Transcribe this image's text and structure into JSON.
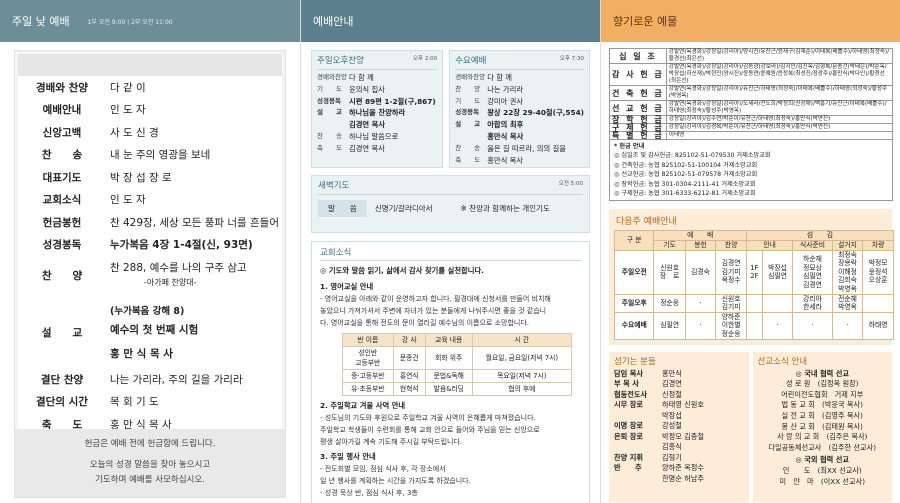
{
  "col1": {
    "header": "주일 낮 예배",
    "subtitle": "1부 오전 9:00 | 2부 오전 11:00",
    "order": [
      {
        "label": "경배와 찬양",
        "value": "다 같 이",
        "bold": false
      },
      {
        "label": "예배안내",
        "value": "인 도 자",
        "bold": false
      },
      {
        "label": "신앙고백",
        "value": "사 도 신 경",
        "bold": false
      },
      {
        "label": "찬　　송",
        "value": "내 눈 주의 영광을 보네",
        "bold": false
      },
      {
        "label": "대표기도",
        "value": "박 장 섭 장 로",
        "bold": false
      },
      {
        "label": "교회소식",
        "value": "인 도 자",
        "bold": false
      },
      {
        "label": "헌금봉헌",
        "value": "찬 429장, 세상 모든 풍파 너를 흔들어",
        "bold": false
      },
      {
        "label": "성경봉독",
        "value": "누가복음 4장 1-4절(신, 93면)",
        "bold": true
      }
    ],
    "praise": {
      "label": "찬　　양",
      "line1": "찬 288, 예수를 나의 구주 삼고",
      "line2": "-아가페 찬양대-"
    },
    "sermon": {
      "label": "설　　교",
      "line1": "(누가복음 강해 8)",
      "line2": "예수의 첫 번째 시험",
      "line3": "홍 만 식 목 사"
    },
    "closing": [
      {
        "label": "결단 찬양",
        "value": "나는 가리라, 주의 길을 가리라"
      },
      {
        "label": "결단의 시간",
        "value": "목 회 기 도"
      },
      {
        "label": "축　　도",
        "value": "홍 만 식 목 사"
      }
    ],
    "footer": [
      "헌금은 예배 전에 헌금함에 드립니다.",
      "오늘의 성경 말씀을 찾아 놓으시고",
      "기도하며 예배를 사모하십시오."
    ]
  },
  "col2": {
    "header": "예배안내",
    "sun_pm": {
      "title": "주일오후찬양",
      "time": "오후 2:00",
      "rows": [
        {
          "l": "경배와찬양",
          "v": "다 함 께",
          "b": false
        },
        {
          "l": "기　　도",
          "v": "윤의식 집사",
          "b": false
        },
        {
          "l": "성경봉독",
          "v": "시편 89편 1-2절(구,867)",
          "b": true
        },
        {
          "l": "설　　교",
          "v": "하나님을 찬양하라",
          "b": true
        },
        {
          "l": "",
          "v": "김경연 목사",
          "b": true
        },
        {
          "l": "찬　　송",
          "v": "하나님 말씀으로",
          "b": false
        },
        {
          "l": "축　　도",
          "v": "김경연 목사",
          "b": false
        }
      ]
    },
    "wed": {
      "title": "수요예배",
      "time": "오후 7:30",
      "rows": [
        {
          "l": "경배와찬양",
          "v": "다 함 께",
          "b": false
        },
        {
          "l": "찬　　양",
          "v": "나는 가리라",
          "b": false
        },
        {
          "l": "기　　도",
          "v": "강미아 권사",
          "b": false
        },
        {
          "l": "성경봉독",
          "v": "왕상 22장 29-40절(구,554)",
          "b": true
        },
        {
          "l": "설　　교",
          "v": "아합의 최후",
          "b": true
        },
        {
          "l": "",
          "v": "홍만식 목사",
          "b": true
        },
        {
          "l": "찬　　송",
          "v": "옳은 길 따르라, 의의 길을",
          "b": false
        },
        {
          "l": "축　　도",
          "v": "홍만식 목사",
          "b": false
        }
      ]
    },
    "dawn": {
      "title": "새벽기도",
      "time": "오전 5:00",
      "key": "말　　씀",
      "value": "신명기/갈라디아서",
      "note": "※ 찬양과 함께하는 개인기도"
    },
    "news": {
      "title": "교회소식",
      "lead": "◎ 기도와 말씀 읽기, 삶에서 감사 찾기를 실천합니다.",
      "s1_title": "1. 영어교실 안내",
      "s1_lines": [
        "- 영어교실을 아래와 같이 운영하고자 합니다. 필경대에 신청서를 만들어 비치해",
        "  놓았으니 가져가셔서 주변에 자녀가 있는 분들에게 나눠주시면 좋을 것 같습니",
        "  다. 영어교실을 통해 전도의 문이 열리길 예수님의 이름으로 소망합니다."
      ],
      "table_head": [
        "반 이름",
        "강 사",
        "교육 내용",
        "시 간"
      ],
      "table_rows": [
        [
          "성인반\n고등부반",
          "문종건",
          "회화 위주",
          "월요일, 금요일(저녁 7시)"
        ],
        [
          "중·고등부반",
          "홍연식",
          "문법&독해",
          "목요일(저녁 7시)"
        ],
        [
          "유·초등부반",
          "현혁석",
          "발음&리딩",
          "협의 후에"
        ]
      ],
      "s2_title": "2. 주일학교 겨울 사역 안내",
      "s2_lines": [
        "- 성도님의 기도와 후원으로 주일학교 겨울 사역이 은혜롭게 마쳐졌습니다.",
        "  주일학교 학생들이 수련회를 통해 교회 안으로 들어와 주님을 믿는 신앙으로",
        "  평생 살아가길 계속 기도해 주시길 부탁드립니다."
      ],
      "s3_title": "3. 주일 행사 안내",
      "s3_lines": [
        "- 전도회별 모임, 점심 식사 후, 각 장소에서",
        "  일 년 행사를 계획하는 시간을 가지도록 하겠습니다.",
        "- 성경 묵상 반, 점심 식사 후, 3층"
      ]
    }
  },
  "col3": {
    "header": "향기로운 예물",
    "giving": [
      {
        "k": "십 일 조",
        "v": "강발연(옥경화)/강창일(강리아)/양시진/유찬근/윤재구(김재순)/이태복(배틀수)/하태영(최정숙)/황경선(최은선)"
      },
      {
        "k": "감 사 헌 금",
        "v": "강발연(옥경화)/강창일(강리아)/김동광(강보라)/김지인/김진옥/김형복/문종건(박태은)/박순옥/박장섭(하신재)/박현진(양시진)/윤동연/윤예원/윤정복(최성진/정광주)/홍만식(박다인)/황경선(최은선)"
      },
      {
        "k": "건 축 헌 금",
        "v": "강발연(옥경화)/강창일(강리아)/유찬근/하태영(최정숙)/이태복(배틀수)/하태영(최정숙)/황성주(박영옥)"
      },
      {
        "k": "선 교 헌 금",
        "v": "강발연(옥경화)/강창일(강리아)/도세라/전도희/박정희(신상애)/백흥기/유찬근/이태복(배틀수)/하태영(최정숙)/황성주(박영옥)"
      },
      {
        "k": "장 학 헌 금",
        "v": "강창일(강리아)/김수연/박순이/유찬근/하태영(최정숙)/홍만식(박연진)"
      },
      {
        "k": "구 제 헌 금",
        "v": "강창일(강리아)/김경복/박순이/유찬근/하태영(최정숙)/홍만식(박연진)"
      },
      {
        "k": "특 별 헌 금",
        "v": "이태영"
      }
    ],
    "accounts_title": "* 헌금 안내",
    "accounts": [
      "◎ 십일조 및 감사헌금: 825102-51-079530 거제소망교회",
      "◎ 건축헌금: 농협 825102-51-100104 거제소망교회",
      "◎ 선교헌금: 농협 825102-51-079578 거제소망교회",
      "◎ 장학헌금: 농협 301-0304-2111-41 거제소망교회",
      "◎ 구제헌금: 농협 301-6333-6212-81 거제소망교회"
    ],
    "usher": {
      "title": "다음주 예배안내",
      "head1": [
        "구 분",
        "예　　배",
        "섬　　김"
      ],
      "head2": [
        "기도",
        "봉헌",
        "찬양",
        "안내",
        "식사준비",
        "설거지",
        "차량"
      ],
      "rows": [
        [
          "주일오전",
          "신원호\n장　로",
          "김경숙",
          "김경연\n김기미\n옥정수",
          "1F\n2F",
          "박장섭\n심필연",
          "하순재\n정묘상\n심필연\n김경연",
          "최정숙\n장용락\n이해정\n김희숙\n박영옥",
          "박정모\n윤정석\n오상훈"
        ],
        [
          "주일오후",
          "정순웅",
          "·",
          "신원호\n김기미",
          "",
          "",
          "강리아\n한세라",
          "전순혜\n박영옥",
          ""
        ],
        [
          "수요예배",
          "심필연",
          "·",
          "양하준\n이한별\n정순웅",
          "",
          "·",
          "·",
          "·",
          "하태영"
        ]
      ]
    },
    "servants": {
      "title": "섬기는 분들",
      "rows": [
        {
          "k": "담임 목사",
          "v": "홍만식"
        },
        {
          "k": "부 목 사",
          "v": "김경연"
        },
        {
          "k": "협동전도사",
          "v": "신정철"
        },
        {
          "k": "시무 장로",
          "v": "하태영 신원호\n박장섭"
        },
        {
          "k": "이명 장로",
          "v": "강성철"
        },
        {
          "k": "은퇴 장로",
          "v": "박정모 김종철\n김흥식"
        },
        {
          "k": "찬양 지휘",
          "v": "김형기"
        },
        {
          "k": "반　　주",
          "v": "양하준 옥정수\n한명순 허남주"
        }
      ]
    },
    "missions": {
      "title": "선교소식 안내",
      "domestic": "◎ 국내 협력 선교",
      "d_rows": [
        "성 로 원　(김정옥 원장)",
        "어린이전도협회　거제 지부",
        "법 동 교 회　(박윤국 목사)",
        "실 전 교 회　(김영주 목사)",
        "봉 산 교 회　(김태원 목사)",
        "사 랑 의 교 회　(김주은 목사)",
        "다일공동체선교사　(김주한 선교사)"
      ],
      "foreign": "◎ 국외 협력 선교",
      "f_rows": [
        "인　　도　(최XX 선교사)",
        "미　얀　마　(이XX 선교사)"
      ]
    }
  }
}
